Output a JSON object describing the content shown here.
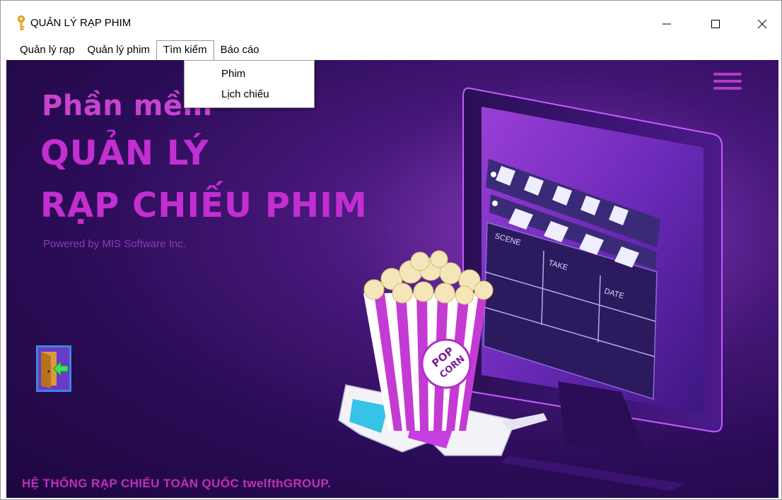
{
  "window": {
    "title": "QUẢN LÝ RẠP PHIM",
    "icon": "key-icon"
  },
  "window_controls": {
    "minimize": "minimize-icon",
    "maximize": "maximize-icon",
    "close": "close-icon"
  },
  "menu": {
    "items": [
      {
        "label": "Quản lý rạp"
      },
      {
        "label": "Quản lý phim"
      },
      {
        "label": "Tìm kiếm"
      },
      {
        "label": "Báo cáo"
      }
    ],
    "open_index": 2,
    "dropdown": [
      {
        "label": "Phim"
      },
      {
        "label": "Lịch chiếu"
      }
    ]
  },
  "hero": {
    "line1": "Phần mềm",
    "line2": "QUẢN LÝ",
    "line3": "RẠP CHIẾU PHIM",
    "powered": "Powered by MIS Software Inc.",
    "popcorn_label_1": "POP",
    "popcorn_label_2": "CORN",
    "clapper_scene": "SCENE",
    "clapper_take": "TAKE",
    "clapper_date": "DATE"
  },
  "footer": {
    "text": "HỆ THỐNG RẠP CHIẾU TOÀN QUỐC twelfthGROUP."
  },
  "colors": {
    "accent": "#c22ed0",
    "background_dark": "#2b0c57",
    "background_mid": "#6f2fa8"
  },
  "icons": {
    "exit": "exit-door-icon",
    "menu": "hamburger-menu-icon"
  }
}
